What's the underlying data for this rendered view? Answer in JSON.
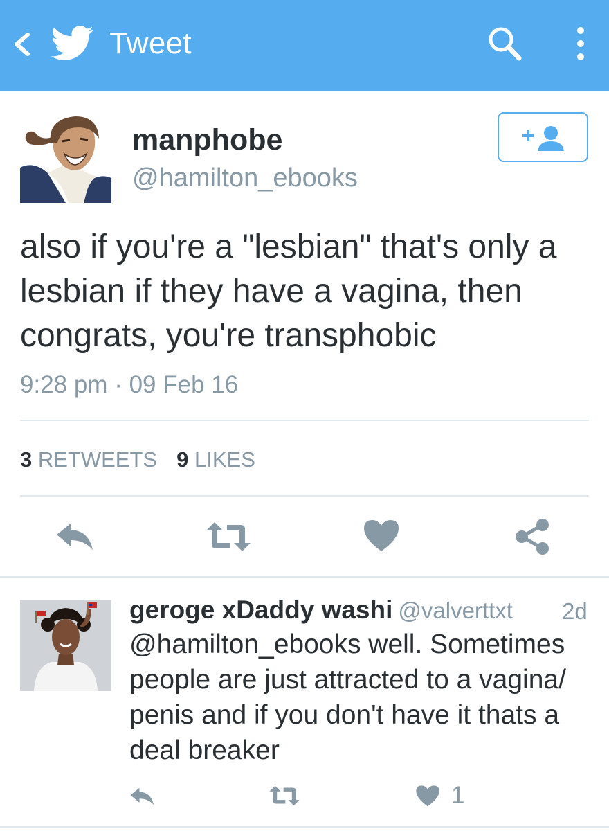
{
  "topbar": {
    "title": "Tweet",
    "color": "#55acee",
    "icons": [
      "back-arrow-icon",
      "twitter-bird-icon",
      "search-icon",
      "overflow-menu-icon"
    ]
  },
  "tweet": {
    "display_name": "manphobe",
    "handle": "@hamilton_ebooks",
    "text": "also if you're a \"lesbian\" that's only a lesbian if they have a vagina, then congrats, you're transphobic",
    "timestamp": "9:28 pm · 09 Feb 16",
    "retweets_count": "3",
    "retweets_label": "RETWEETS",
    "likes_count": "9",
    "likes_label": "LIKES",
    "follow_icon": "add-user-icon",
    "actions": [
      "reply-icon",
      "retweet-icon",
      "heart-icon",
      "share-icon"
    ]
  },
  "reply": {
    "display_name": "geroge xDaddy washi",
    "handle": "@valverttxt",
    "time": "2d",
    "text": "@hamilton_ebooks well. Sometimes people are just attracted to a vagina/ penis and if you don't have it thats a deal breaker",
    "like_count": "1",
    "actions": [
      "reply-icon",
      "retweet-icon",
      "heart-icon"
    ]
  },
  "colors": {
    "accent": "#55acee",
    "text": "#292f33",
    "muted": "#8899a6",
    "action_icon": "#8899a6",
    "divider": "#e1e8ed"
  }
}
